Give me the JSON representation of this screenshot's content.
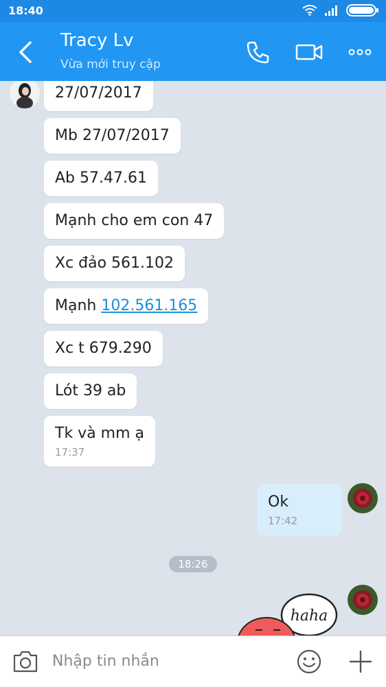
{
  "status": {
    "time": "18:40"
  },
  "header": {
    "title": "Tracy Lv",
    "subtitle": "Vừa mới truy cập"
  },
  "messages_in": [
    {
      "text": "27/07/2017"
    },
    {
      "text": "Mb 27/07/2017"
    },
    {
      "text": "Ab 57.47.61"
    },
    {
      "text": "Mạnh cho em con 47"
    },
    {
      "text": "Xc đảo 561.102"
    },
    {
      "prefix": "Mạnh ",
      "link": "102.561.165"
    },
    {
      "text": "Xc t 679.290"
    },
    {
      "text": "Lót 39 ab"
    },
    {
      "text": "Tk và mm ạ",
      "time": "17:37"
    }
  ],
  "message_out": {
    "text": "Ok",
    "time": "17:42"
  },
  "time_chip": "18:26",
  "sticker_text": "haha",
  "input": {
    "placeholder": "Nhập tin nhắn"
  },
  "colors": {
    "appbar": "#2196f3",
    "outgoing_bubble": "#d8eefc",
    "link": "#1a8fd8"
  }
}
